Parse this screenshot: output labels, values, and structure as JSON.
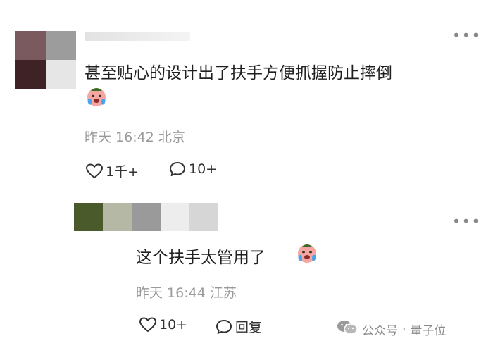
{
  "comments": [
    {
      "text": "甚至贴心的设计出了扶手方便抓握防止摔倒",
      "emoji": "crying-face-emoji",
      "time": "昨天 16:42",
      "location": "北京",
      "like_count": "1千+",
      "reply_count": "10+"
    },
    {
      "text": "这个扶手太管用了",
      "emoji": "crying-face-emoji",
      "time": "昨天 16:44",
      "location": "江苏",
      "like_count": "10+",
      "reply_label": "回复"
    }
  ],
  "watermark": {
    "dot": "·",
    "channel": "公众号",
    "account": "量子位"
  },
  "colors": {
    "text": "#1f1f1f",
    "meta": "#9a9a9a",
    "emoji_face": "#f6a6a0",
    "tear": "#4aa3e8",
    "avatar1": [
      "#7a5a5e",
      "#9c9c9c",
      "#4a2b2f",
      "#ffffff"
    ],
    "avatar2": [
      "#4a5a2a",
      "#b5b8a5",
      "#9a9a9a",
      "#ededed",
      "#d9d9d9"
    ]
  }
}
